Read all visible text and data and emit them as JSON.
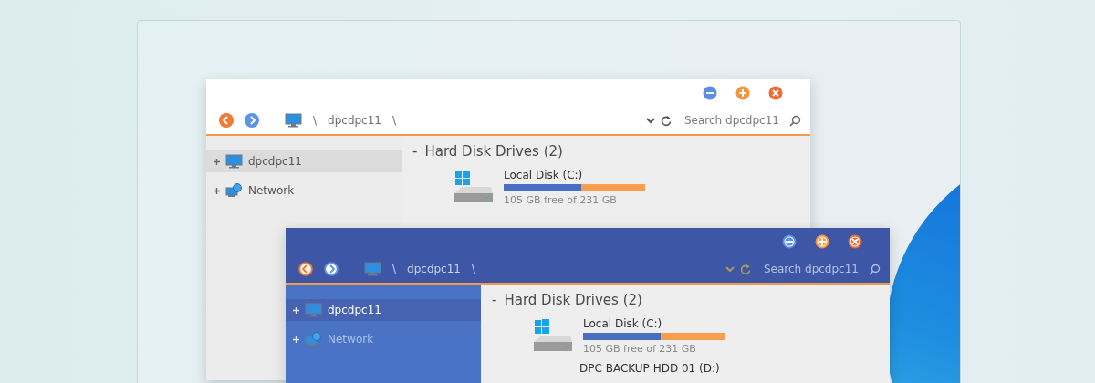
{
  "windows": [
    {
      "kind": "light",
      "path": [
        "\\",
        "dpcdpc11",
        "\\"
      ],
      "search": {
        "placeholder": "Search dpcdpc11"
      },
      "sidebar": {
        "items": [
          {
            "label": "dpcdpc11",
            "kind": "computer",
            "selected": true
          },
          {
            "label": "Network",
            "kind": "network",
            "selected": false
          }
        ]
      },
      "section": {
        "toggle": "-",
        "title": "Hard Disk Drives (2)"
      },
      "drives": [
        {
          "name": "Local Disk (C:)",
          "level": 0.55,
          "free": "105 GB free of 231 GB"
        }
      ]
    },
    {
      "kind": "dark",
      "path": [
        "\\",
        "dpcdpc11",
        "\\"
      ],
      "search": {
        "placeholder": "Search dpcdpc11"
      },
      "sidebar": {
        "items": [
          {
            "label": "dpcdpc11",
            "kind": "computer",
            "selected": true
          },
          {
            "label": "Network",
            "kind": "network",
            "selected": false
          }
        ]
      },
      "section": {
        "toggle": "-",
        "title": "Hard Disk Drives (2)"
      },
      "drives": [
        {
          "name": "Local Disk (C:)",
          "level": 0.55,
          "free": "105 GB free of 231 GB"
        },
        {
          "name": "DPC BACKUP HDD 01 (D:)"
        }
      ]
    }
  ]
}
